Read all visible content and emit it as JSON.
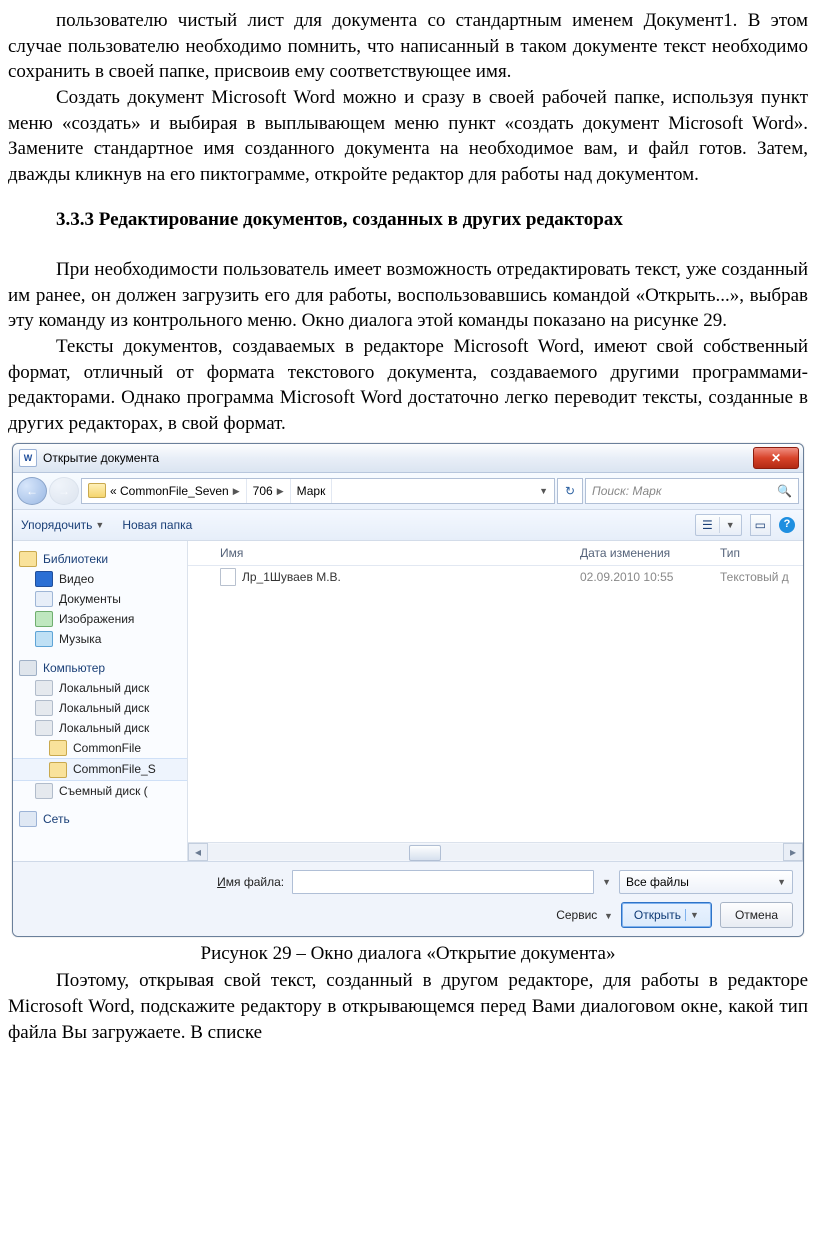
{
  "doc": {
    "p1": "пользователю чистый лист для документа со стандартным именем Документ1. В этом случае пользователю необходимо помнить, что написанный в таком документе текст необходимо сохранить в своей папке, присвоив ему соответствующее имя.",
    "p2": "Создать документ Microsoft Word можно и сразу в своей рабочей папке, используя пункт меню «создать» и выбирая в выплывающем меню пункт «создать документ Microsoft Word». Замените стандартное имя созданного документа на необходимое вам, и файл готов. Затем, дважды кликнув на его пиктограмме, откройте редактор для работы над документом.",
    "heading": "3.3.3 Редактирование документов, созданных в других редакторах",
    "p3": "При необходимости пользователь имеет возможность отредактировать текст, уже созданный им ранее, он должен загрузить его для работы, воспользовавшись командой «Открыть...», выбрав эту команду из контрольного меню. Окно диалога этой команды показано на рисунке 29.",
    "p4": "Тексты документов, создаваемых в редакторе Microsoft Word, имеют свой собственный формат, отличный от формата текстового документа, создаваемого другими программами-редакторами. Однако программа Microsoft Word достаточно легко переводит тексты, созданные в других редакторах, в свой формат.",
    "figcaption": "Рисунок 29 – Окно диалога «Открытие документа»",
    "p5": "Поэтому, открывая свой текст, созданный в другом редакторе, для работы в редакторе Microsoft Word, подскажите редактору в открывающемся перед Вами диалоговом окне, какой тип файла Вы загружаете. В списке"
  },
  "dialog": {
    "title": "Открытие документа",
    "breadcrumb": {
      "root": "«  CommonFile_Seven",
      "seg2": "706",
      "seg3": "Марк"
    },
    "search_placeholder": "Поиск: Марк",
    "toolbar": {
      "organize": "Упорядочить",
      "newfolder": "Новая папка"
    },
    "columns": {
      "name": "Имя",
      "date": "Дата изменения",
      "type": "Тип"
    },
    "nav": {
      "libraries": "Библиотеки",
      "video": "Видео",
      "documents": "Документы",
      "pictures": "Изображения",
      "music": "Музыка",
      "computer": "Компьютер",
      "drive1": "Локальный диск",
      "drive2": "Локальный диск",
      "drive3": "Локальный диск",
      "folder_cf": "CommonFile",
      "folder_cfs": "CommonFile_S",
      "removable": "Съемный диск (",
      "network": "Сеть"
    },
    "file": {
      "name": "Лр_1Шуваев М.В.",
      "date": "02.09.2010 10:55",
      "type": "Текстовый д"
    },
    "footer": {
      "filename_label": "Имя файла:",
      "filter": "Все файлы",
      "service": "Сервис",
      "open": "Открыть",
      "cancel": "Отмена"
    }
  }
}
